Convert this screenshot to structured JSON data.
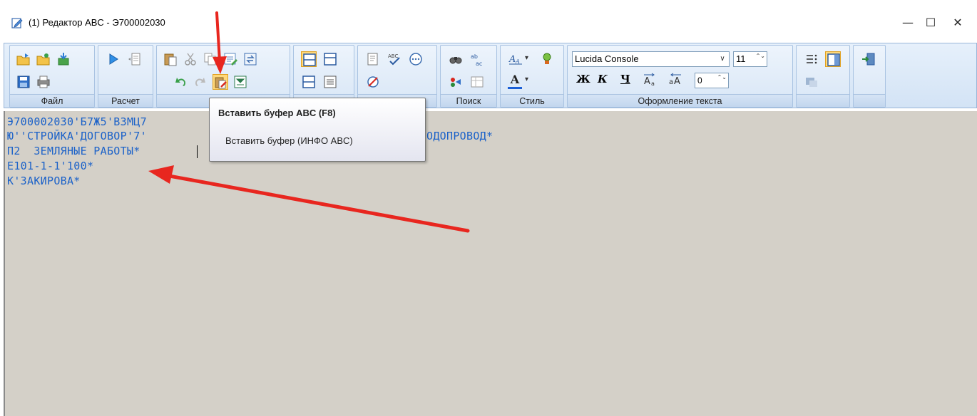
{
  "window": {
    "title": "(1) Редактор ABC - Э700002030",
    "minimize_glyph": "—",
    "maximize_glyph": "☐",
    "close_glyph": "✕"
  },
  "ribbon": {
    "groups": [
      {
        "label": "Файл"
      },
      {
        "label": "Расчет"
      },
      {
        "label": "Редак"
      },
      {
        "label": ""
      },
      {
        "label": ""
      },
      {
        "label": "Поиск"
      },
      {
        "label": "Стиль"
      },
      {
        "label": "Оформление текста"
      },
      {
        "label": ""
      },
      {
        "label": ""
      }
    ],
    "font_name": "Lucida Console",
    "font_size": "11",
    "indent_value": "0",
    "bold_glyph": "Ж",
    "italic_glyph": "К",
    "underline_glyph": "Ч",
    "dropdown_glyph": "▾",
    "select_arrow_glyph": "∨",
    "spin_glyph": "⌃⌄",
    "font_color_glyph": "A",
    "mark_glyph": "A"
  },
  "editor": {
    "lines": [
      "Э700002030'Б7Ж5'В3МЦ7",
      "Ю''СТРОЙКА'ДОГОВОР'7'",
      "П2  ЗЕМЛЯНЫЕ РАБОТЫ*",
      "Е101-1-1'100*",
      "К'ЗАКИРОВА*"
    ],
    "line_tail": "ОДОПРОВОД*"
  },
  "tooltip": {
    "title": "Вставить буфер ABC (F8)",
    "body": "Вставить буфер (ИНФО ABC)"
  },
  "colors": {
    "text_blue": "#1c62c9",
    "editor_bg": "#d4d0c8",
    "arrow_red": "#e8261f"
  }
}
